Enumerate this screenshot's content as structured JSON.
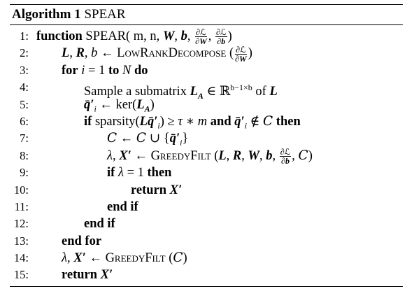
{
  "algorithm": {
    "label": "Algorithm 1",
    "name": "SPEAR"
  },
  "lines": [
    {
      "num": "1:",
      "indent": 0,
      "segments": [
        {
          "t": "kw",
          "v": "function"
        },
        {
          "t": "text",
          "v": " SPEAR( m, n, "
        },
        {
          "t": "mb",
          "v": "W"
        },
        {
          "t": "text",
          "v": ", "
        },
        {
          "t": "mb",
          "v": "b"
        },
        {
          "t": "text",
          "v": ", "
        },
        {
          "t": "frac",
          "num": "∂ℒ",
          "den": "∂W"
        },
        {
          "t": "text",
          "v": ", "
        },
        {
          "t": "frac",
          "num": "∂ℒ",
          "den": "∂b"
        },
        {
          "t": "text",
          "v": ")"
        }
      ]
    },
    {
      "num": "2:",
      "indent": 1,
      "segments": [
        {
          "t": "mb",
          "v": "L"
        },
        {
          "t": "text",
          "v": ", "
        },
        {
          "t": "mb",
          "v": "R"
        },
        {
          "t": "text",
          "v": ", "
        },
        {
          "t": "m",
          "v": "b"
        },
        {
          "t": "text",
          "v": " ← "
        },
        {
          "t": "sc",
          "v": "LowRankDecompose"
        },
        {
          "t": "text",
          "v": " ("
        },
        {
          "t": "frac",
          "num": "∂ℒ",
          "den": "∂W"
        },
        {
          "t": "text",
          "v": ")"
        }
      ]
    },
    {
      "num": "3:",
      "indent": 1,
      "segments": [
        {
          "t": "kw",
          "v": "for"
        },
        {
          "t": "text",
          "v": " "
        },
        {
          "t": "m",
          "v": "i"
        },
        {
          "t": "text",
          "v": " = 1 "
        },
        {
          "t": "kw",
          "v": "to"
        },
        {
          "t": "text",
          "v": " "
        },
        {
          "t": "m",
          "v": "N"
        },
        {
          "t": "text",
          "v": " "
        },
        {
          "t": "kw",
          "v": "do"
        }
      ]
    },
    {
      "num": "4:",
      "indent": 2,
      "segments": [
        {
          "t": "text",
          "v": "Sample a submatrix "
        },
        {
          "t": "mb",
          "v": "L"
        },
        {
          "t": "sub",
          "v": "A"
        },
        {
          "t": "text",
          "v": " ∈ ℝ"
        },
        {
          "t": "sup",
          "v": "b−1×b"
        },
        {
          "t": "text",
          "v": " of "
        },
        {
          "t": "mb",
          "v": "L"
        }
      ]
    },
    {
      "num": "5:",
      "indent": 2,
      "segments": [
        {
          "t": "mb",
          "v": "q̄′"
        },
        {
          "t": "sub",
          "v": "i"
        },
        {
          "t": "text",
          "v": " ← ker("
        },
        {
          "t": "mb",
          "v": "L"
        },
        {
          "t": "sub",
          "v": "A"
        },
        {
          "t": "text",
          "v": ")"
        }
      ]
    },
    {
      "num": "6:",
      "indent": 2,
      "segments": [
        {
          "t": "kw",
          "v": "if"
        },
        {
          "t": "text",
          "v": " sparsity("
        },
        {
          "t": "mb",
          "v": "Lq̄′"
        },
        {
          "t": "sub",
          "v": "i"
        },
        {
          "t": "text",
          "v": ") ≥ "
        },
        {
          "t": "m",
          "v": "τ"
        },
        {
          "t": "text",
          "v": " ∗ "
        },
        {
          "t": "m",
          "v": "m"
        },
        {
          "t": "text",
          "v": " "
        },
        {
          "t": "kw",
          "v": "and"
        },
        {
          "t": "text",
          "v": " "
        },
        {
          "t": "mb",
          "v": "q̄′"
        },
        {
          "t": "sub",
          "v": "i"
        },
        {
          "t": "text",
          "v": " ∉ "
        },
        {
          "t": "cal",
          "v": "C"
        },
        {
          "t": "text",
          "v": " "
        },
        {
          "t": "kw",
          "v": "then"
        }
      ]
    },
    {
      "num": "7:",
      "indent": 3,
      "segments": [
        {
          "t": "cal",
          "v": "C"
        },
        {
          "t": "text",
          "v": " ← "
        },
        {
          "t": "cal",
          "v": "C"
        },
        {
          "t": "text",
          "v": " ∪ {"
        },
        {
          "t": "mb",
          "v": "q̄′"
        },
        {
          "t": "sub",
          "v": "i"
        },
        {
          "t": "text",
          "v": "}"
        }
      ]
    },
    {
      "num": "8:",
      "indent": 3,
      "segments": [
        {
          "t": "m",
          "v": "λ"
        },
        {
          "t": "text",
          "v": ", "
        },
        {
          "t": "mb",
          "v": "X′"
        },
        {
          "t": "text",
          "v": " ← "
        },
        {
          "t": "sc",
          "v": "GreedyFilt"
        },
        {
          "t": "text",
          "v": " ("
        },
        {
          "t": "mb",
          "v": "L"
        },
        {
          "t": "text",
          "v": ", "
        },
        {
          "t": "mb",
          "v": "R"
        },
        {
          "t": "text",
          "v": ", "
        },
        {
          "t": "mb",
          "v": "W"
        },
        {
          "t": "text",
          "v": ", "
        },
        {
          "t": "mb",
          "v": "b"
        },
        {
          "t": "text",
          "v": ", "
        },
        {
          "t": "frac",
          "num": "∂ℒ",
          "den": "∂b"
        },
        {
          "t": "text",
          "v": ", "
        },
        {
          "t": "cal",
          "v": "C"
        },
        {
          "t": "text",
          "v": ")"
        }
      ]
    },
    {
      "num": "9:",
      "indent": 3,
      "segments": [
        {
          "t": "kw",
          "v": "if"
        },
        {
          "t": "text",
          "v": " "
        },
        {
          "t": "m",
          "v": "λ"
        },
        {
          "t": "text",
          "v": " = 1 "
        },
        {
          "t": "kw",
          "v": "then"
        }
      ]
    },
    {
      "num": "10:",
      "indent": 4,
      "segments": [
        {
          "t": "kw",
          "v": "return"
        },
        {
          "t": "text",
          "v": " "
        },
        {
          "t": "mb",
          "v": "X′"
        }
      ]
    },
    {
      "num": "11:",
      "indent": 3,
      "segments": [
        {
          "t": "kw",
          "v": "end if"
        }
      ]
    },
    {
      "num": "12:",
      "indent": 2,
      "segments": [
        {
          "t": "kw",
          "v": "end if"
        }
      ]
    },
    {
      "num": "13:",
      "indent": 1,
      "segments": [
        {
          "t": "kw",
          "v": "end for"
        }
      ]
    },
    {
      "num": "14:",
      "indent": 1,
      "segments": [
        {
          "t": "m",
          "v": "λ"
        },
        {
          "t": "text",
          "v": ", "
        },
        {
          "t": "mb",
          "v": "X′"
        },
        {
          "t": "text",
          "v": " ← "
        },
        {
          "t": "sc",
          "v": "GreedyFilt"
        },
        {
          "t": "text",
          "v": " ("
        },
        {
          "t": "cal",
          "v": "C"
        },
        {
          "t": "text",
          "v": ")"
        }
      ]
    },
    {
      "num": "15:",
      "indent": 1,
      "segments": [
        {
          "t": "kw",
          "v": "return"
        },
        {
          "t": "text",
          "v": " "
        },
        {
          "t": "mb",
          "v": "X′"
        }
      ]
    }
  ]
}
